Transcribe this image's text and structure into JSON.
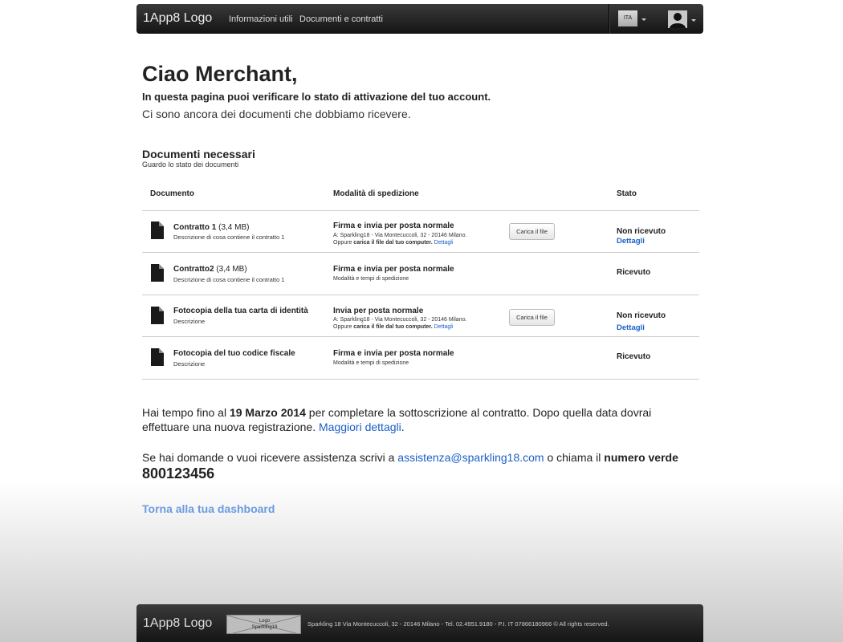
{
  "navbar": {
    "brand": "1App8 Logo",
    "links": [
      "Informazioni utili",
      "Documenti e contratti"
    ],
    "language": "ITA"
  },
  "main": {
    "greeting": "Ciao Merchant,",
    "intro_strong": "In questa pagina puoi verificare lo stato di attivazione del tuo account.",
    "intro": "Ci sono ancora dei documenti che dobbiamo ricevere.",
    "section_title": "Documenti necessari",
    "section_subtitle": "Guardo lo stato dei documenti"
  },
  "table": {
    "headers": [
      "Documento",
      "Modalità di spedizione",
      "Stato"
    ],
    "rows": [
      {
        "name": "Contratto 1",
        "size": " (3,4 MB)",
        "description": "Descrizione di cosa contiene il contratto 1",
        "ship_title": "Firma e invia per posta normale",
        "ship_line1": "A: Sparkling18 - Via Montecuccoli, 32 - 20146 Milano.",
        "ship_line2_pre": "Oppure ",
        "ship_line2_bold": "carica il file dal tuo computer.",
        "ship_line2_link": " Dettagli",
        "upload_label": "Carica il file",
        "status": "Non ricevuto",
        "status_link": "Dettagli"
      },
      {
        "name": "Contratto2",
        "size": " (3,4 MB)",
        "description": "Descrizione di cosa contiene il contratto 1",
        "ship_title": "Firma e invia per posta normale",
        "ship_line1": "Modalità e tempi di spedizione",
        "status": "Ricevuto"
      },
      {
        "name": "Fotocopia della tua carta di identità",
        "size": "",
        "description": "Descrizione",
        "ship_title": "Invia per posta normale",
        "ship_line1": "A: Sparkling18 - Via Montecuccoli, 32 - 20146 Milano.",
        "ship_line2_pre": "Oppure ",
        "ship_line2_bold": "carica il file dal tuo computer.",
        "ship_line2_link": " Dettagli",
        "upload_label": "Carica il file",
        "status": "Non ricevuto",
        "status_link": "Dettagli"
      },
      {
        "name": "Fotocopia del tuo codice fiscale",
        "size": "",
        "description": "Descrizione",
        "ship_title": "Firma e invia per posta normale",
        "ship_line1": "Modalità e tempi di spedizione",
        "status": "Ricevuto"
      }
    ]
  },
  "deadline": {
    "pre": "Hai tempo fino al ",
    "date": "19 Marzo 2014",
    "post": " per completare la sottoscrizione al contratto. Dopo quella data dovrai effettuare una nuova registrazione. ",
    "link": "Maggiori dettagli",
    "end": "."
  },
  "support": {
    "pre": "Se hai domande o vuoi ricevere assistenza scrivi a ",
    "email": "assistenza@sparkling18.com",
    "mid": " o chiama il ",
    "label": "numero verde",
    "number": "800123456"
  },
  "back_link": "Torna alla tua dashboard",
  "footer": {
    "brand": "1App8 Logo",
    "logo_line1": "Logo",
    "logo_line2": "Sparkling18",
    "text": "Sparkling 18 Via Montecuccoli, 32 - 20146 Milano - Tel. 02.4951.9180 - P.I. IT 07866180966 © All rights reserved."
  },
  "colors": {
    "link": "#1a5fc8",
    "back_link": "#6b9be0",
    "navbar": "#1e1e1e"
  }
}
